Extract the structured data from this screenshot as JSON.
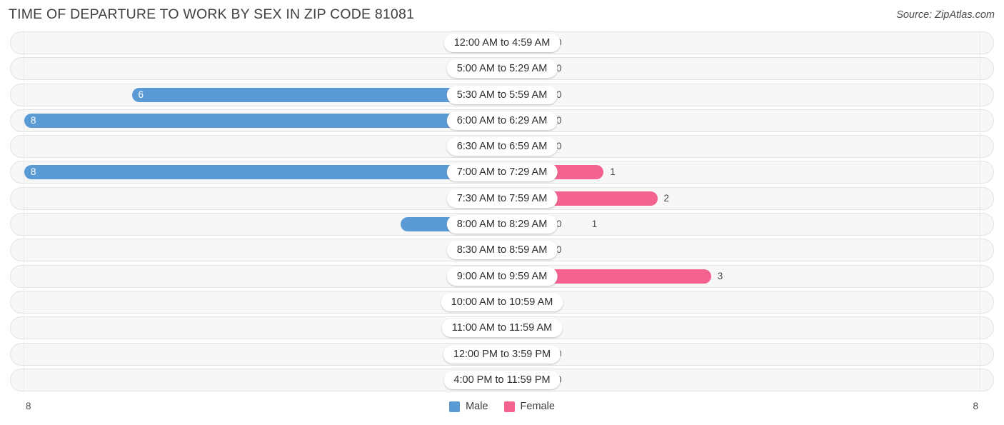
{
  "header": {
    "title": "TIME OF DEPARTURE TO WORK BY SEX IN ZIP CODE 81081",
    "source": "Source: ZipAtlas.com"
  },
  "legend": {
    "male_label": "Male",
    "female_label": "Female",
    "male_color": "#5b9bd5",
    "female_color": "#f4628f",
    "male_color_light": "#afcbee",
    "female_color_light": "#f7a8c4"
  },
  "axis": {
    "min_label": "8",
    "max_label": "8",
    "scale_max": 8
  },
  "chart_data": {
    "type": "bar",
    "title": "TIME OF DEPARTURE TO WORK BY SEX IN ZIP CODE 81081",
    "xlabel": "",
    "ylabel": "",
    "orientation": "horizontal-diverging",
    "xlim": [
      8,
      8
    ],
    "grid": false,
    "legend_position": "bottom-center",
    "categories": [
      "12:00 AM to 4:59 AM",
      "5:00 AM to 5:29 AM",
      "5:30 AM to 5:59 AM",
      "6:00 AM to 6:29 AM",
      "6:30 AM to 6:59 AM",
      "7:00 AM to 7:29 AM",
      "7:30 AM to 7:59 AM",
      "8:00 AM to 8:29 AM",
      "8:30 AM to 8:59 AM",
      "9:00 AM to 9:59 AM",
      "10:00 AM to 10:59 AM",
      "11:00 AM to 11:59 AM",
      "12:00 PM to 3:59 PM",
      "4:00 PM to 11:59 PM"
    ],
    "series": [
      {
        "name": "Male",
        "values": [
          0,
          0,
          6,
          8,
          0,
          8,
          0,
          1,
          0,
          0,
          0,
          0,
          0,
          0
        ]
      },
      {
        "name": "Female",
        "values": [
          0,
          0,
          0,
          0,
          0,
          1,
          2,
          0,
          0,
          3,
          0,
          0,
          0,
          0
        ]
      }
    ]
  }
}
